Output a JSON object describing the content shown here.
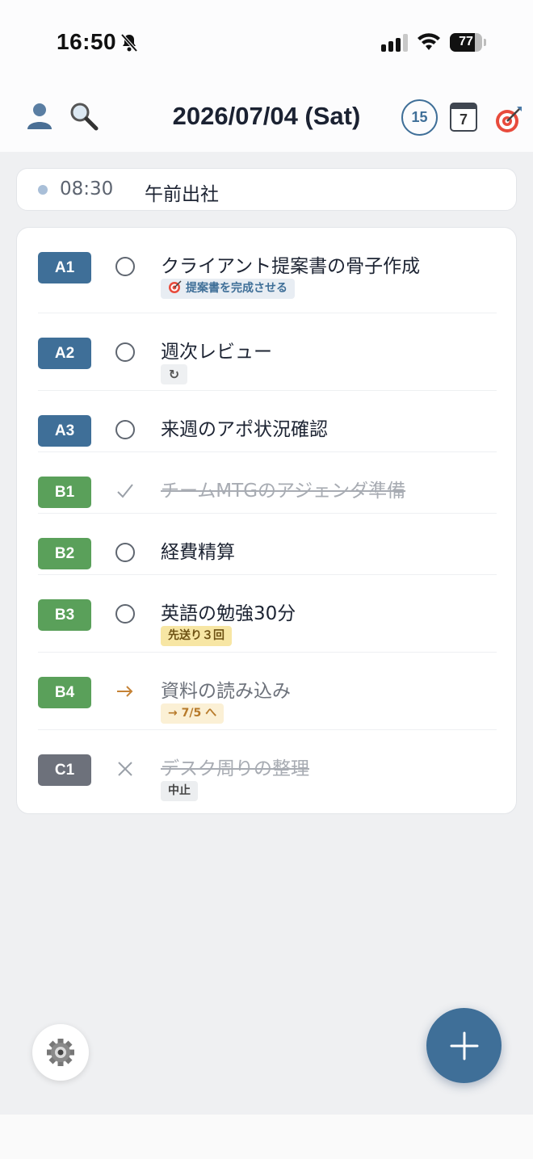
{
  "status_bar": {
    "time": "16:50",
    "battery": "77",
    "battery_level": 0.77
  },
  "header": {
    "date": "2026/07/04 (Sat)",
    "month_badge": "15",
    "week_badge": "7"
  },
  "time_event": {
    "time": "08:30",
    "label": "午前出社"
  },
  "tasks": [
    {
      "tag": "A1",
      "status": "open",
      "title": "クライアント提案書の骨子作成",
      "sub": "提案書を完成させる",
      "sub_icon": "target-icon"
    },
    {
      "tag": "A2",
      "status": "open",
      "title": "週次レビュー",
      "sub": "↻",
      "sub_icon": "repeat-icon"
    },
    {
      "tag": "A3",
      "status": "open",
      "title": "来週のアポ状況確認"
    },
    {
      "tag": "B1",
      "status": "done",
      "title": "チームMTGのアジェンダ準備"
    },
    {
      "tag": "B2",
      "status": "open",
      "title": "経費精算"
    },
    {
      "tag": "B3",
      "status": "open",
      "title": "英語の勉強30分",
      "sub": "先送り３回"
    },
    {
      "tag": "B4",
      "status": "moved",
      "title": "資料の読み込み",
      "sub": "→ 7/5 へ"
    },
    {
      "tag": "C1",
      "status": "cancelled",
      "title": "デスク周りの整理",
      "sub": "中止"
    }
  ],
  "colors": {
    "accent": "#3f6f98",
    "tag_a": "#3f6f98",
    "tag_b": "#5aa05a",
    "tag_c": "#6d717b"
  }
}
